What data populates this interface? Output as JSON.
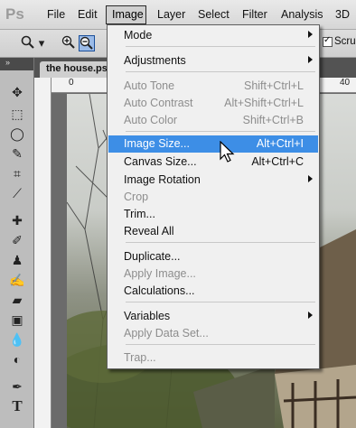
{
  "app": {
    "logo": "Ps"
  },
  "menubar": [
    "File",
    "Edit",
    "Image",
    "Layer",
    "Select",
    "Filter",
    "Analysis",
    "3D"
  ],
  "options": {
    "scrub_label": "Scrub"
  },
  "document": {
    "tab_label": "the house.ps",
    "ruler_ticks": [
      "0",
      "40"
    ]
  },
  "image_menu": {
    "items": [
      {
        "label": "Mode",
        "shortcut": "",
        "submenu": true,
        "disabled": false
      },
      {
        "label": "Adjustments",
        "shortcut": "",
        "submenu": true,
        "disabled": false
      },
      {
        "label": "Auto Tone",
        "shortcut": "Shift+Ctrl+L",
        "submenu": false,
        "disabled": true
      },
      {
        "label": "Auto Contrast",
        "shortcut": "Alt+Shift+Ctrl+L",
        "submenu": false,
        "disabled": true
      },
      {
        "label": "Auto Color",
        "shortcut": "Shift+Ctrl+B",
        "submenu": false,
        "disabled": true
      },
      {
        "label": "Image Size...",
        "shortcut": "Alt+Ctrl+I",
        "submenu": false,
        "disabled": false,
        "highlighted": true
      },
      {
        "label": "Canvas Size...",
        "shortcut": "Alt+Ctrl+C",
        "submenu": false,
        "disabled": false
      },
      {
        "label": "Image Rotation",
        "shortcut": "",
        "submenu": true,
        "disabled": false
      },
      {
        "label": "Crop",
        "shortcut": "",
        "submenu": false,
        "disabled": true
      },
      {
        "label": "Trim...",
        "shortcut": "",
        "submenu": false,
        "disabled": false
      },
      {
        "label": "Reveal All",
        "shortcut": "",
        "submenu": false,
        "disabled": false
      },
      {
        "label": "Duplicate...",
        "shortcut": "",
        "submenu": false,
        "disabled": false
      },
      {
        "label": "Apply Image...",
        "shortcut": "",
        "submenu": false,
        "disabled": true
      },
      {
        "label": "Calculations...",
        "shortcut": "",
        "submenu": false,
        "disabled": false
      },
      {
        "label": "Variables",
        "shortcut": "",
        "submenu": true,
        "disabled": false
      },
      {
        "label": "Apply Data Set...",
        "shortcut": "",
        "submenu": false,
        "disabled": true
      },
      {
        "label": "Trap...",
        "shortcut": "",
        "submenu": false,
        "disabled": true
      }
    ]
  },
  "colors": {
    "highlight": "#3d8ee6",
    "menu_bg": "#f0f0f0",
    "disabled_text": "#8d8d8d"
  },
  "tools": [
    "move-icon",
    "marquee-icon",
    "lasso-icon",
    "quick-select-icon",
    "crop-icon",
    "eyedropper-icon",
    "healing-icon",
    "brush-icon",
    "clone-stamp-icon",
    "history-brush-icon",
    "eraser-icon",
    "gradient-icon",
    "blur-icon",
    "dodge-icon",
    "pen-icon",
    "type-icon"
  ]
}
